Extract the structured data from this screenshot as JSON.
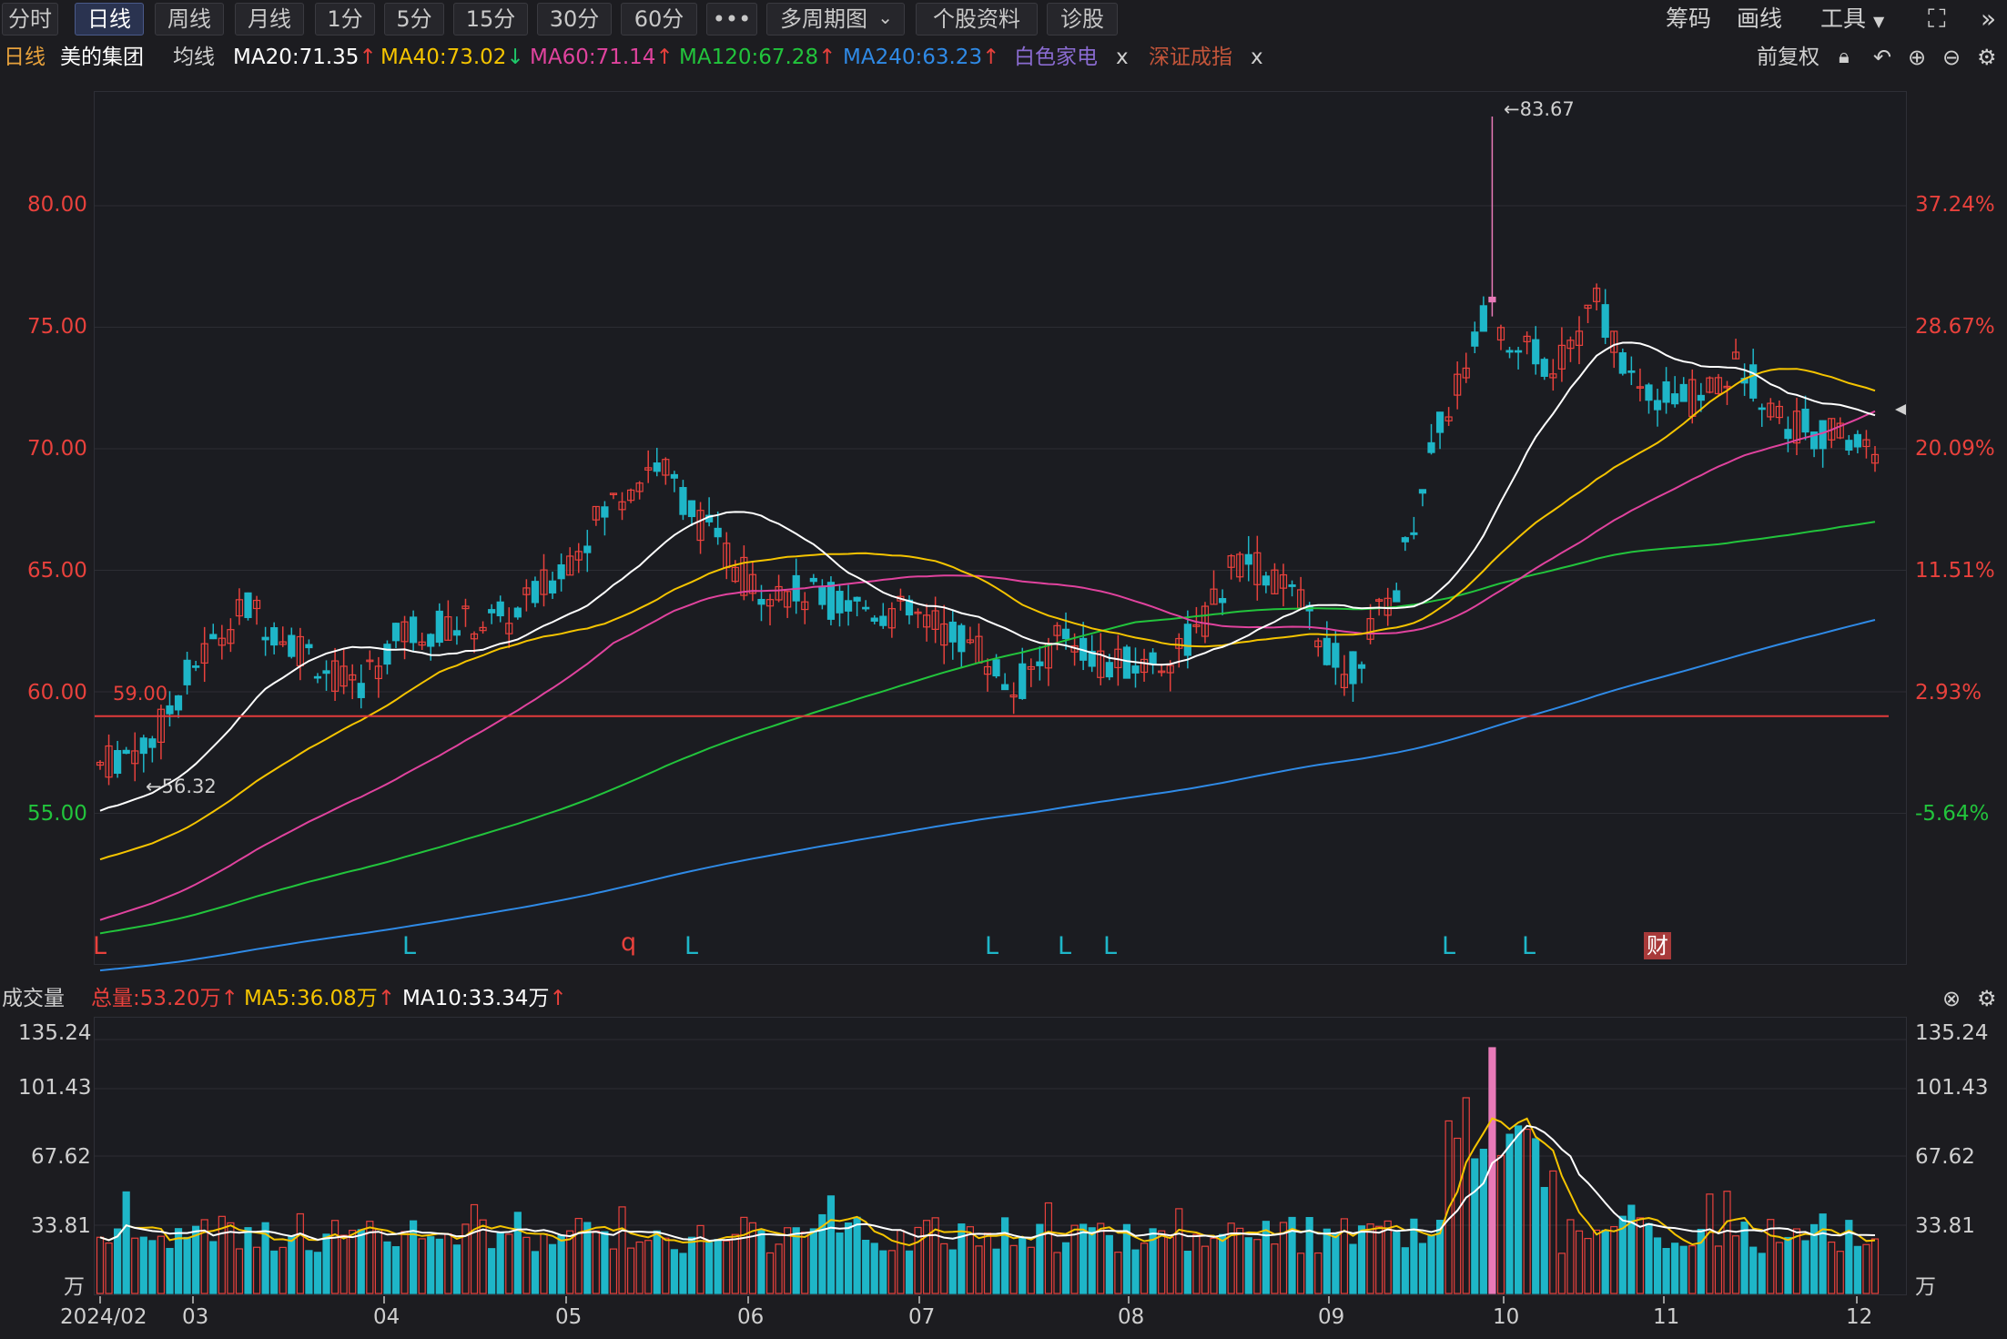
{
  "toolbar": {
    "buttons": [
      "分时",
      "日线",
      "周线",
      "月线",
      "1分",
      "5分",
      "15分",
      "30分",
      "60分",
      "•••",
      "多周期图",
      "个股资料",
      "诊股"
    ],
    "active": "日线",
    "right_items": [
      "筹码",
      "画线",
      "工具"
    ]
  },
  "info": {
    "period": "日线",
    "stock_name": "美的集团",
    "ma_label": "均线",
    "ma20": "MA20:71.35",
    "ma40": "MA40:73.02",
    "ma60": "MA60:71.14",
    "ma120": "MA120:67.28",
    "ma240": "MA240:63.23",
    "overlay1": "白色家电",
    "overlay2": "深证成指",
    "close_x": "x",
    "adjust": "前复权"
  },
  "colors": {
    "up": "#e8413c",
    "down": "#1eb6c8",
    "ma20": "#ffffff",
    "ma40": "#f5c400",
    "ma60": "#e0439e",
    "ma120": "#22c43c",
    "ma240": "#2f8ae6",
    "support_line": "#e23b3b"
  },
  "price_axis": {
    "left_ticks": [
      "80.00",
      "75.00",
      "70.00",
      "65.00",
      "60.00",
      "55.00"
    ],
    "right_ticks": [
      "37.24%",
      "28.67%",
      "20.09%",
      "11.51%",
      "2.93%",
      "-5.64%"
    ]
  },
  "annotations": {
    "high": "←83.67",
    "low": "←56.32",
    "support": "59.00"
  },
  "signal_markers": [
    "L",
    "L",
    "q",
    "L",
    "L",
    "L",
    "L",
    "L",
    "L",
    "财"
  ],
  "volume": {
    "label": "成交量",
    "total": "总量:53.20万",
    "ma5": "MA5:36.08万",
    "ma10": "MA10:33.34万",
    "left_ticks": [
      "135.24",
      "101.43",
      "67.62",
      "33.81",
      "万"
    ],
    "right_ticks": [
      "135.24",
      "101.43",
      "67.62",
      "33.81",
      "万"
    ]
  },
  "x_axis": {
    "labels": [
      "2024/02",
      "03",
      "04",
      "05",
      "06",
      "07",
      "08",
      "09",
      "10",
      "11",
      "12"
    ]
  }
}
